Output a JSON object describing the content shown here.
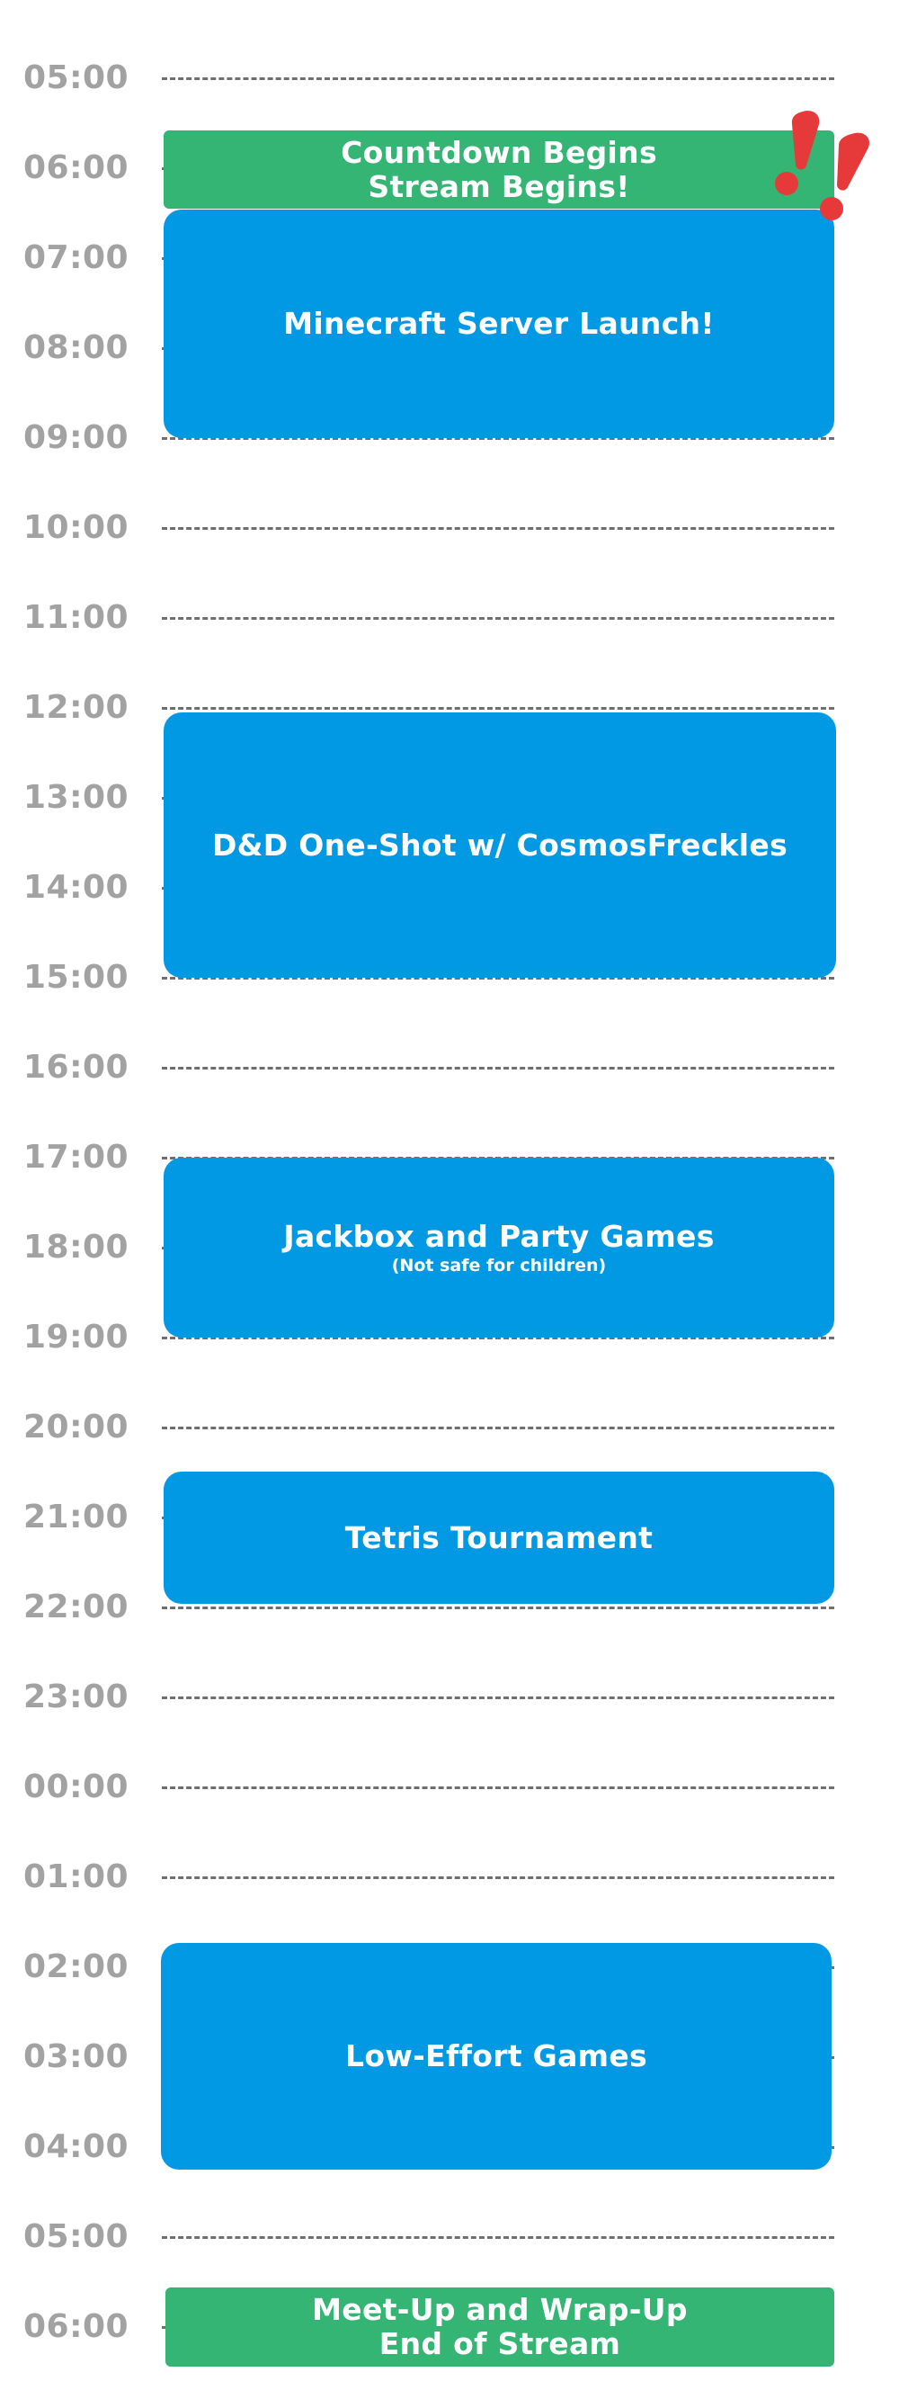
{
  "hours": [
    "05:00",
    "06:00",
    "07:00",
    "08:00",
    "09:00",
    "10:00",
    "11:00",
    "12:00",
    "13:00",
    "14:00",
    "15:00",
    "16:00",
    "17:00",
    "18:00",
    "19:00",
    "20:00",
    "21:00",
    "22:00",
    "23:00",
    "00:00",
    "01:00",
    "02:00",
    "03:00",
    "04:00",
    "05:00",
    "06:00"
  ],
  "events": {
    "countdown": {
      "line1": "Countdown Begins",
      "line2": "Stream Begins!",
      "color": "#34b574"
    },
    "minecraft": {
      "title": "Minecraft Server Launch!",
      "color": "#0299e4"
    },
    "dnd": {
      "title": "D&D One-Shot w/ CosmosFreckles",
      "color": "#0299e4"
    },
    "jackbox": {
      "title": "Jackbox and Party Games",
      "subtitle": "(Not safe for children)",
      "color": "#0299e4"
    },
    "tetris": {
      "title": "Tetris Tournament",
      "color": "#0299e4"
    },
    "low_effort": {
      "title": "Low-Effort  Games",
      "color": "#0299e4"
    },
    "wrapup": {
      "line1": "Meet-Up and Wrap-Up",
      "line2": "End of Stream",
      "color": "#34b574"
    }
  },
  "decoration": {
    "exclamation_icon": "double-exclamation-icon",
    "exclamation_color": "#e63a3a"
  }
}
